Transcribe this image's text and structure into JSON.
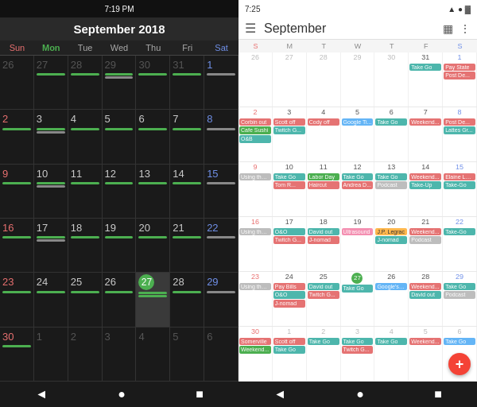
{
  "left": {
    "status": "7:19 PM",
    "title": "September 2018",
    "days_of_week": [
      "Sun",
      "Mon",
      "Tue",
      "Wed",
      "Thu",
      "Fri",
      "Sat"
    ],
    "weeks": [
      [
        "26",
        "27",
        "28",
        "29",
        "30",
        "31",
        "1"
      ],
      [
        "2",
        "3",
        "4",
        "5",
        "6",
        "7",
        "8"
      ],
      [
        "9",
        "10",
        "11",
        "12",
        "13",
        "14",
        "15"
      ],
      [
        "16",
        "17",
        "18",
        "19",
        "20",
        "21",
        "22"
      ],
      [
        "23",
        "24",
        "25",
        "26",
        "27",
        "28",
        "29"
      ],
      [
        "30",
        "1",
        "2",
        "3",
        "4",
        "5",
        "6"
      ]
    ],
    "today_day": "27",
    "today_week": 4,
    "today_col": 3
  },
  "right": {
    "status_time": "7:25",
    "title": "September",
    "days_of_week": [
      "S",
      "M",
      "T",
      "W",
      "T",
      "F",
      "S"
    ],
    "fab_label": "+"
  },
  "nav": {
    "back": "◄",
    "home": "●",
    "recents": "■"
  }
}
